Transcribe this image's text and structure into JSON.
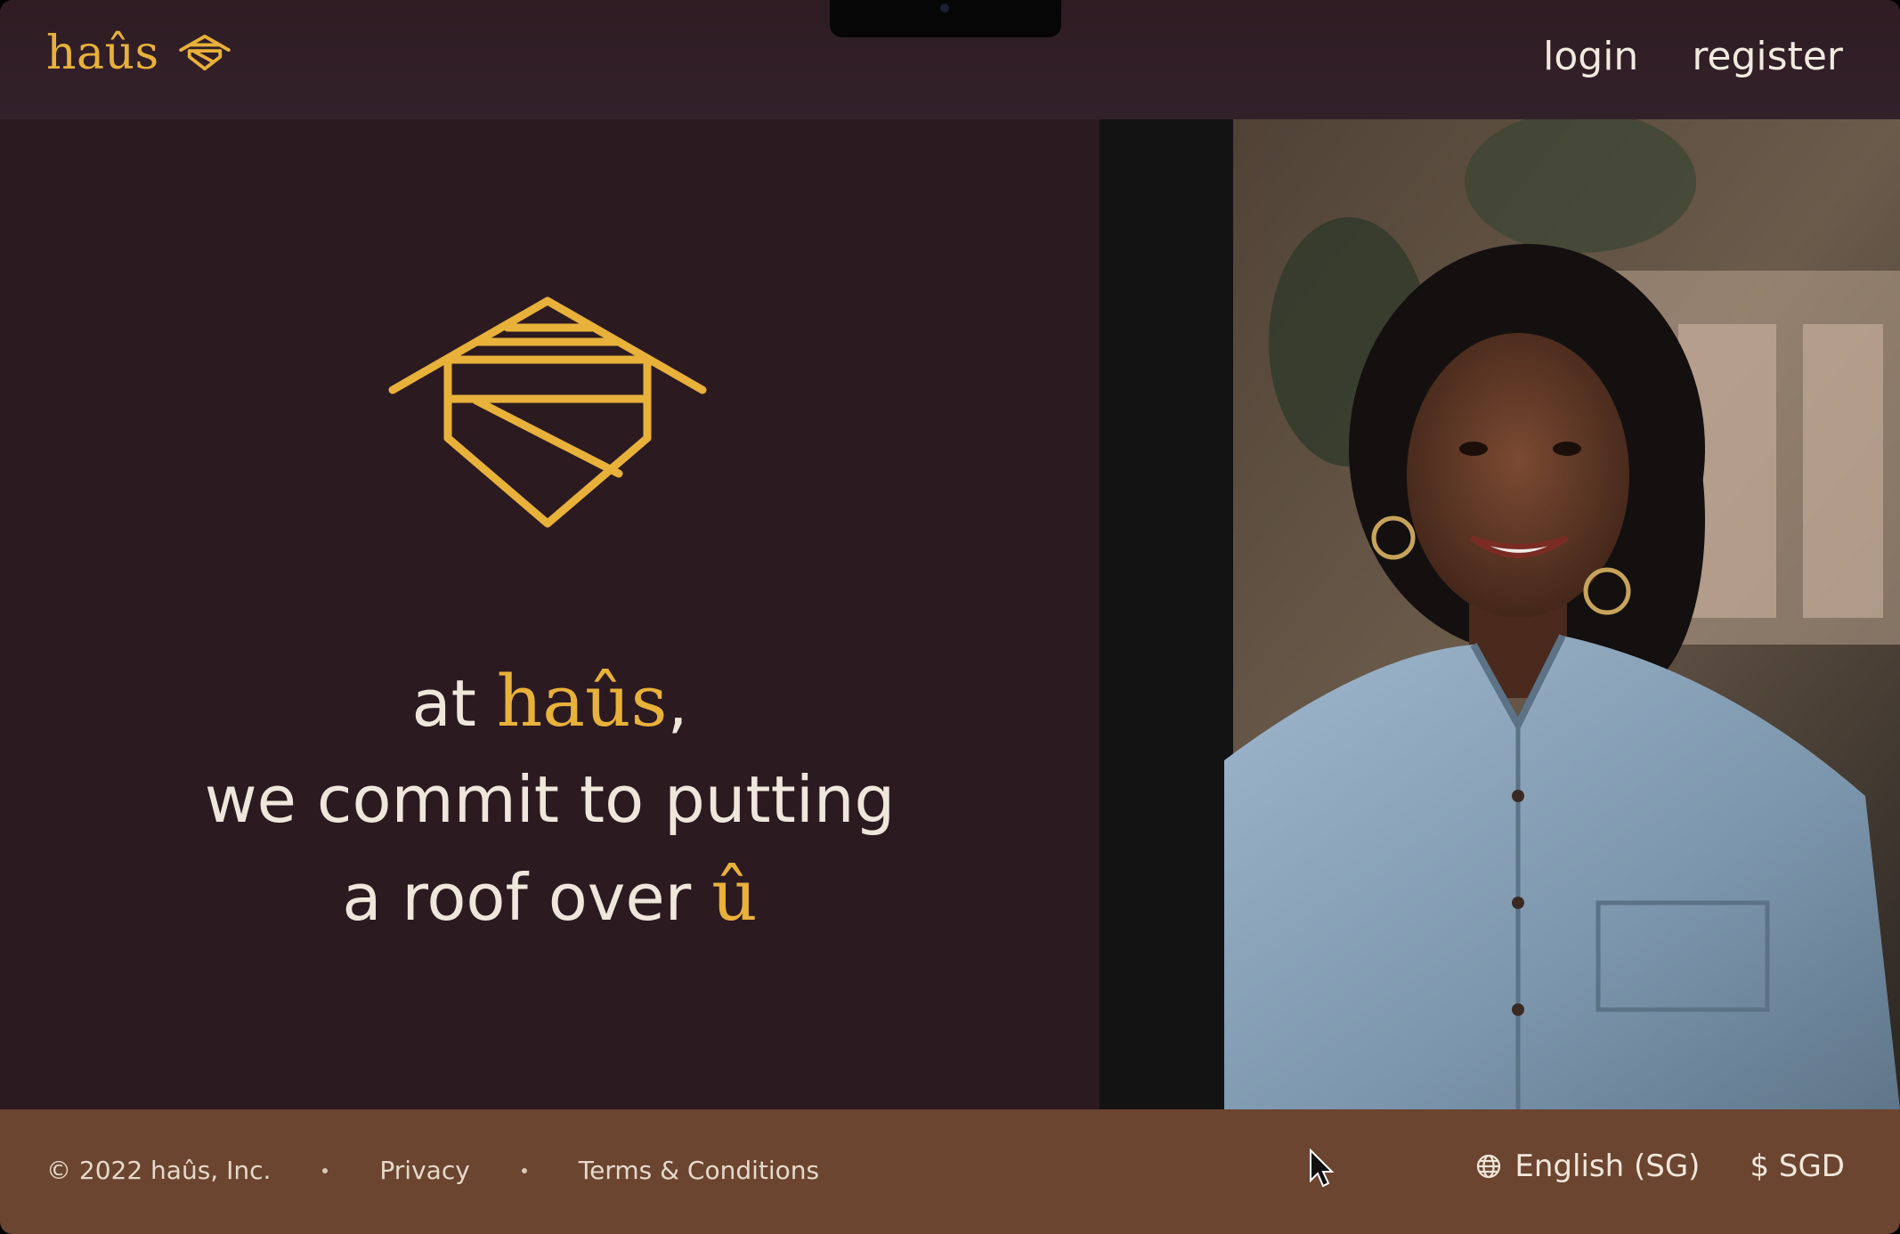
{
  "header": {
    "brand_name": "haûs",
    "nav": {
      "login": "login",
      "register": "register"
    }
  },
  "hero": {
    "tagline": {
      "line1_prefix": "at",
      "line1_brand": "haûs",
      "line1_suffix": ",",
      "line2": "we commit to putting",
      "line3_prefix": "a roof over",
      "line3_accent": "û"
    }
  },
  "footer": {
    "copyright": "© 2022 haûs, Inc.",
    "privacy": "Privacy",
    "terms": "Terms & Conditions",
    "language": "English (SG)",
    "currency": "$ SGD"
  },
  "colors": {
    "brand_accent": "#e8b13a",
    "background": "#2c1a21",
    "footer": "#6b4530",
    "text_light": "#f0e7dc"
  },
  "icons": {
    "brand_logo": "house-hexagon-logo",
    "globe": "globe-icon",
    "cursor": "mouse-pointer"
  }
}
